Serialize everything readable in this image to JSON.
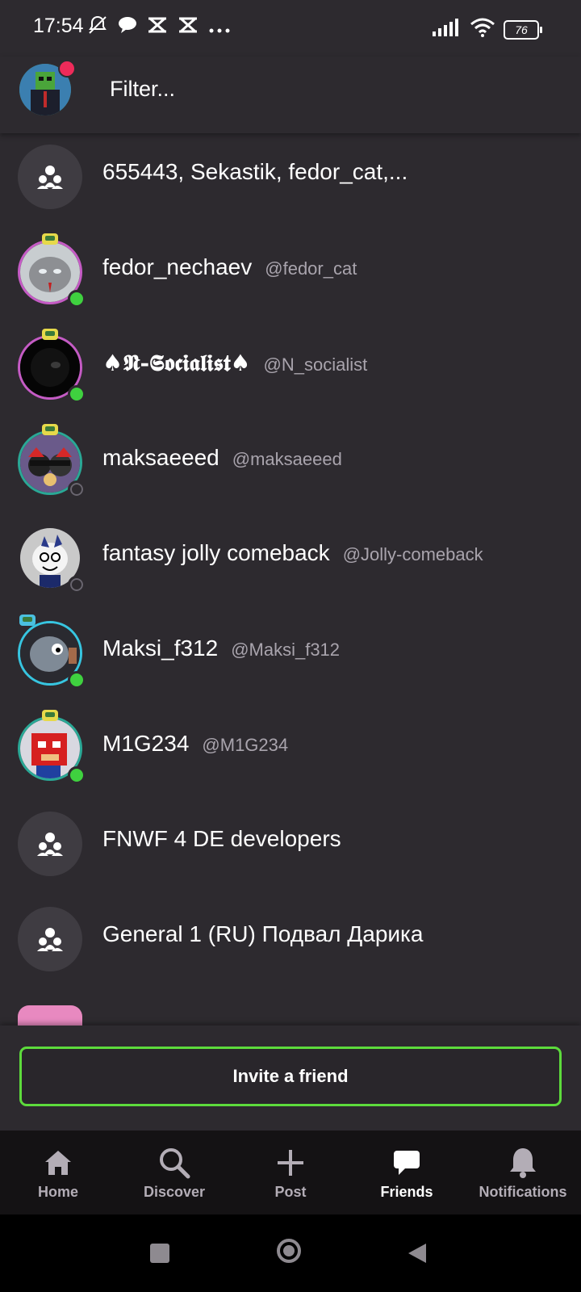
{
  "status_bar": {
    "time": "17:54",
    "battery": "76",
    "left_icons": [
      "bell-off-icon",
      "chat-bubble-icon",
      "capcut-icon",
      "capcut-icon",
      "more-dots-icon"
    ]
  },
  "header": {
    "filter_placeholder": "Filter..."
  },
  "list": [
    {
      "type": "group",
      "display_name": "655443, Sekastik, fedor_cat,...",
      "username": ""
    },
    {
      "type": "user",
      "display_name": "fedor_nechaev",
      "username": "@fedor_cat",
      "online": true,
      "ring": "pink"
    },
    {
      "type": "user",
      "display_name": "♠𝕹-𝕾𝖔𝖈𝖎𝖆𝖑𝖎𝖘𝖙♠",
      "username": "@N_socialist",
      "online": true,
      "ring": "pink"
    },
    {
      "type": "user",
      "display_name": "maksaeeed",
      "username": "@maksaeeed",
      "online": false,
      "ring": "teal"
    },
    {
      "type": "user",
      "display_name": "fantasy jolly comeback",
      "username": "@Jolly-comeback",
      "online": false,
      "ring": "none"
    },
    {
      "type": "user",
      "display_name": "Maksi_f312",
      "username": "@Maksi_f312",
      "online": true,
      "ring": "cyan"
    },
    {
      "type": "user",
      "display_name": "M1G234",
      "username": "@M1G234",
      "online": true,
      "ring": "teal"
    },
    {
      "type": "group",
      "display_name": "FNWF 4 DE developers",
      "username": ""
    },
    {
      "type": "group",
      "display_name": "General 1 (RU) Подвал Дарика",
      "username": ""
    }
  ],
  "invite": {
    "label": "Invite a friend",
    "accent_color": "#5ddb3c"
  },
  "bottom_nav": [
    {
      "label": "Home",
      "icon": "home-icon",
      "active": false
    },
    {
      "label": "Discover",
      "icon": "search-icon",
      "active": false
    },
    {
      "label": "Post",
      "icon": "plus-icon",
      "active": false
    },
    {
      "label": "Friends",
      "icon": "chat-icon",
      "active": true
    },
    {
      "label": "Notifications",
      "icon": "bell-icon",
      "active": false
    }
  ],
  "colors": {
    "background": "#2d2a2f",
    "online": "#3fd13f",
    "notification_dot": "#ee2b5a"
  }
}
